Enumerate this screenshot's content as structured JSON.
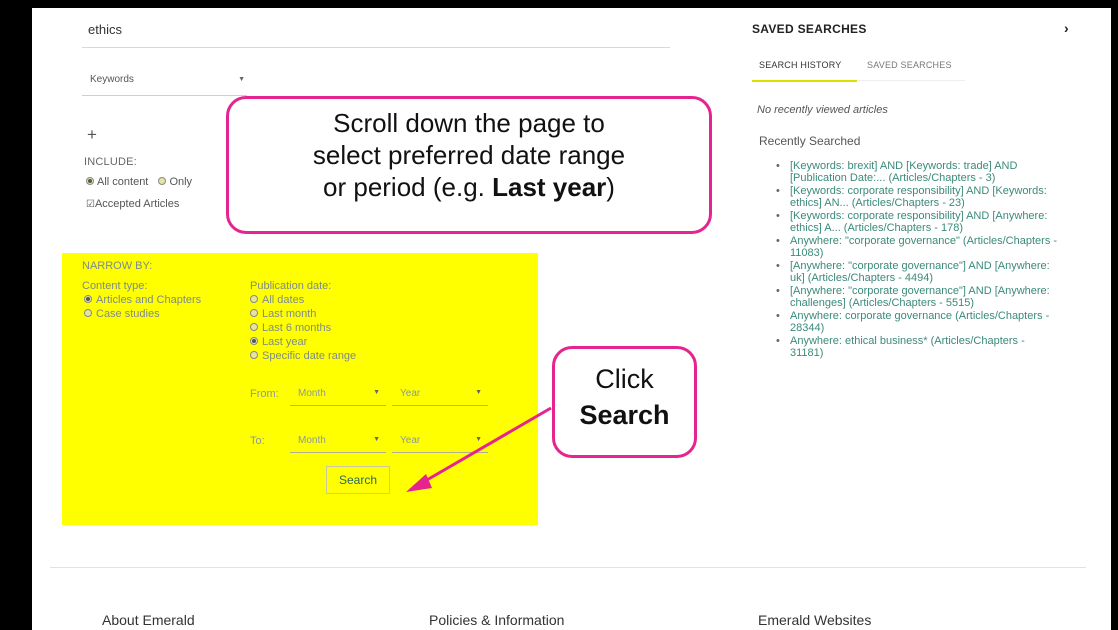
{
  "search": {
    "query": "ethics",
    "field": "Keywords"
  },
  "include": {
    "label": "INCLUDE:",
    "option_all": "All content",
    "option_only": "Only",
    "accepted": "Accepted Articles"
  },
  "narrow": {
    "title": "NARROW BY:",
    "content_type_label": "Content type:",
    "content_types": [
      "Articles and Chapters",
      "Case studies"
    ],
    "publication_date_label": "Publication date:",
    "dates": [
      "All dates",
      "Last month",
      "Last 6 months",
      "Last year",
      "Specific date range"
    ],
    "selected_date": "Last year",
    "from_label": "From:",
    "to_label": "To:",
    "month_placeholder": "Month",
    "year_placeholder": "Year",
    "search_button": "Search"
  },
  "annotations": {
    "scroll_line1": "Scroll down the page to",
    "scroll_line2": "select preferred date range",
    "scroll_line3_pre": "or period (e.g. ",
    "scroll_line3_bold": "Last year",
    "scroll_line3_post": ")",
    "click_line1": "Click",
    "click_line2": "Search",
    "accent_color": "#e6248f"
  },
  "sidebar": {
    "title": "SAVED SEARCHES",
    "tab_history": "SEARCH HISTORY",
    "tab_saved": "SAVED SEARCHES",
    "no_recent": "No recently viewed articles",
    "recent_label": "Recently Searched",
    "recent_items": [
      "[Keywords: brexit] AND [Keywords: trade] AND [Publication Date:... (Articles/Chapters - 3)",
      "[Keywords: corporate responsibility] AND [Keywords: ethics] AN... (Articles/Chapters - 23)",
      "[Keywords: corporate responsibility] AND [Anywhere: ethics] A... (Articles/Chapters - 178)",
      "Anywhere: \"corporate governance\" (Articles/Chapters - 11083)",
      "[Anywhere: \"corporate governance\"] AND [Anywhere: uk] (Articles/Chapters - 4494)",
      "[Anywhere: \"corporate governance\"] AND [Anywhere: challenges] (Articles/Chapters - 5515)",
      "Anywhere: corporate governance (Articles/Chapters - 28344)",
      "Anywhere: ethical business* (Articles/Chapters - 31181)"
    ]
  },
  "footer": {
    "about": "About Emerald",
    "policies": "Policies & Information",
    "websites": "Emerald Websites"
  }
}
